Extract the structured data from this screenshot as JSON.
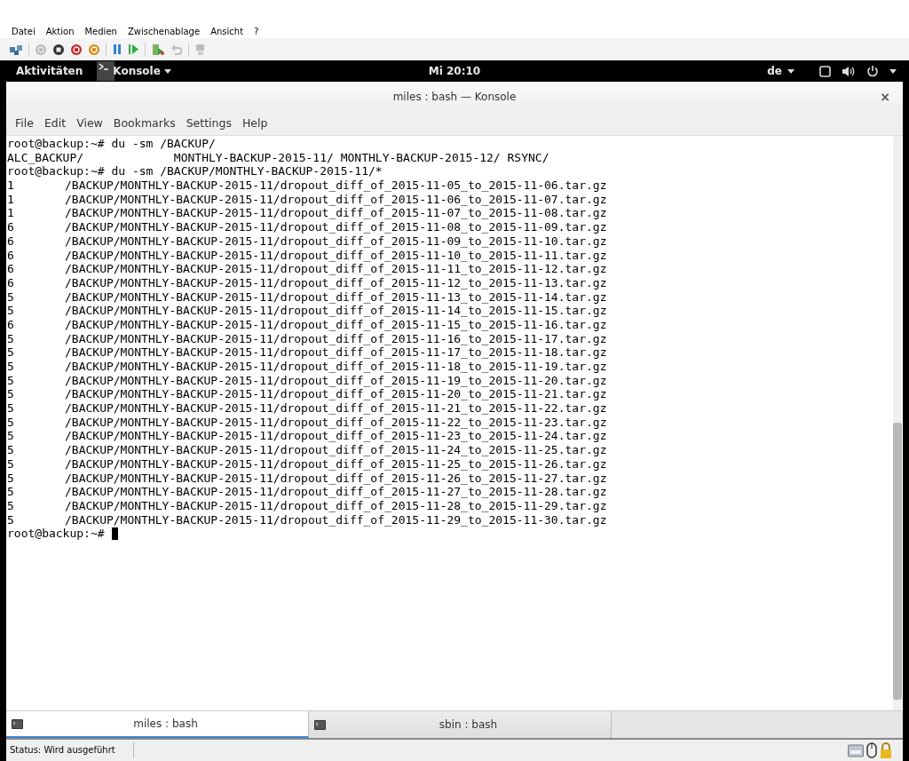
{
  "vm_menu": [
    "Datei",
    "Aktion",
    "Medien",
    "Zwischenablage",
    "Ansicht",
    "?"
  ],
  "top_bar": {
    "activities": "Aktivitäten",
    "app_menu": "Konsole",
    "clock": "Mi 20:10",
    "keyboard_layout": "de"
  },
  "window": {
    "title": "miles : bash — Konsole",
    "close": "×"
  },
  "menu": [
    "File",
    "Edit",
    "View",
    "Bookmarks",
    "Settings",
    "Help"
  ],
  "terminal": {
    "lines": [
      {
        "kind": "text",
        "text": "root@backup:~# du -sm /BACKUP/"
      },
      {
        "kind": "text",
        "text": "ALC_BACKUP/             MONTHLY-BACKUP-2015-11/ MONTHLY-BACKUP-2015-12/ RSYNC/"
      },
      {
        "kind": "text",
        "text": "root@backup:~# du -sm /BACKUP/MONTHLY-BACKUP-2015-11/*"
      },
      {
        "kind": "size",
        "size": "1",
        "path": "/BACKUP/MONTHLY-BACKUP-2015-11/dropout_diff_of_2015-11-05_to_2015-11-06.tar.gz"
      },
      {
        "kind": "size",
        "size": "1",
        "path": "/BACKUP/MONTHLY-BACKUP-2015-11/dropout_diff_of_2015-11-06_to_2015-11-07.tar.gz"
      },
      {
        "kind": "size",
        "size": "1",
        "path": "/BACKUP/MONTHLY-BACKUP-2015-11/dropout_diff_of_2015-11-07_to_2015-11-08.tar.gz"
      },
      {
        "kind": "size",
        "size": "6",
        "path": "/BACKUP/MONTHLY-BACKUP-2015-11/dropout_diff_of_2015-11-08_to_2015-11-09.tar.gz"
      },
      {
        "kind": "size",
        "size": "6",
        "path": "/BACKUP/MONTHLY-BACKUP-2015-11/dropout_diff_of_2015-11-09_to_2015-11-10.tar.gz"
      },
      {
        "kind": "size",
        "size": "6",
        "path": "/BACKUP/MONTHLY-BACKUP-2015-11/dropout_diff_of_2015-11-10_to_2015-11-11.tar.gz"
      },
      {
        "kind": "size",
        "size": "6",
        "path": "/BACKUP/MONTHLY-BACKUP-2015-11/dropout_diff_of_2015-11-11_to_2015-11-12.tar.gz"
      },
      {
        "kind": "size",
        "size": "6",
        "path": "/BACKUP/MONTHLY-BACKUP-2015-11/dropout_diff_of_2015-11-12_to_2015-11-13.tar.gz"
      },
      {
        "kind": "size",
        "size": "5",
        "path": "/BACKUP/MONTHLY-BACKUP-2015-11/dropout_diff_of_2015-11-13_to_2015-11-14.tar.gz"
      },
      {
        "kind": "size",
        "size": "5",
        "path": "/BACKUP/MONTHLY-BACKUP-2015-11/dropout_diff_of_2015-11-14_to_2015-11-15.tar.gz"
      },
      {
        "kind": "size",
        "size": "6",
        "path": "/BACKUP/MONTHLY-BACKUP-2015-11/dropout_diff_of_2015-11-15_to_2015-11-16.tar.gz"
      },
      {
        "kind": "size",
        "size": "5",
        "path": "/BACKUP/MONTHLY-BACKUP-2015-11/dropout_diff_of_2015-11-16_to_2015-11-17.tar.gz"
      },
      {
        "kind": "size",
        "size": "5",
        "path": "/BACKUP/MONTHLY-BACKUP-2015-11/dropout_diff_of_2015-11-17_to_2015-11-18.tar.gz"
      },
      {
        "kind": "size",
        "size": "5",
        "path": "/BACKUP/MONTHLY-BACKUP-2015-11/dropout_diff_of_2015-11-18_to_2015-11-19.tar.gz"
      },
      {
        "kind": "size",
        "size": "5",
        "path": "/BACKUP/MONTHLY-BACKUP-2015-11/dropout_diff_of_2015-11-19_to_2015-11-20.tar.gz"
      },
      {
        "kind": "size",
        "size": "5",
        "path": "/BACKUP/MONTHLY-BACKUP-2015-11/dropout_diff_of_2015-11-20_to_2015-11-21.tar.gz"
      },
      {
        "kind": "size",
        "size": "5",
        "path": "/BACKUP/MONTHLY-BACKUP-2015-11/dropout_diff_of_2015-11-21_to_2015-11-22.tar.gz"
      },
      {
        "kind": "size",
        "size": "5",
        "path": "/BACKUP/MONTHLY-BACKUP-2015-11/dropout_diff_of_2015-11-22_to_2015-11-23.tar.gz"
      },
      {
        "kind": "size",
        "size": "5",
        "path": "/BACKUP/MONTHLY-BACKUP-2015-11/dropout_diff_of_2015-11-23_to_2015-11-24.tar.gz"
      },
      {
        "kind": "size",
        "size": "5",
        "path": "/BACKUP/MONTHLY-BACKUP-2015-11/dropout_diff_of_2015-11-24_to_2015-11-25.tar.gz"
      },
      {
        "kind": "size",
        "size": "5",
        "path": "/BACKUP/MONTHLY-BACKUP-2015-11/dropout_diff_of_2015-11-25_to_2015-11-26.tar.gz"
      },
      {
        "kind": "size",
        "size": "5",
        "path": "/BACKUP/MONTHLY-BACKUP-2015-11/dropout_diff_of_2015-11-26_to_2015-11-27.tar.gz"
      },
      {
        "kind": "size",
        "size": "5",
        "path": "/BACKUP/MONTHLY-BACKUP-2015-11/dropout_diff_of_2015-11-27_to_2015-11-28.tar.gz"
      },
      {
        "kind": "size",
        "size": "5",
        "path": "/BACKUP/MONTHLY-BACKUP-2015-11/dropout_diff_of_2015-11-28_to_2015-11-29.tar.gz"
      },
      {
        "kind": "size",
        "size": "5",
        "path": "/BACKUP/MONTHLY-BACKUP-2015-11/dropout_diff_of_2015-11-29_to_2015-11-30.tar.gz"
      },
      {
        "kind": "prompt",
        "text": "root@backup:~#"
      }
    ]
  },
  "tabs": [
    {
      "label": "miles : bash",
      "selected": true
    },
    {
      "label": "sbin : bash",
      "selected": false
    }
  ],
  "status_bar": {
    "text": "Status: Wird ausgeführt"
  }
}
